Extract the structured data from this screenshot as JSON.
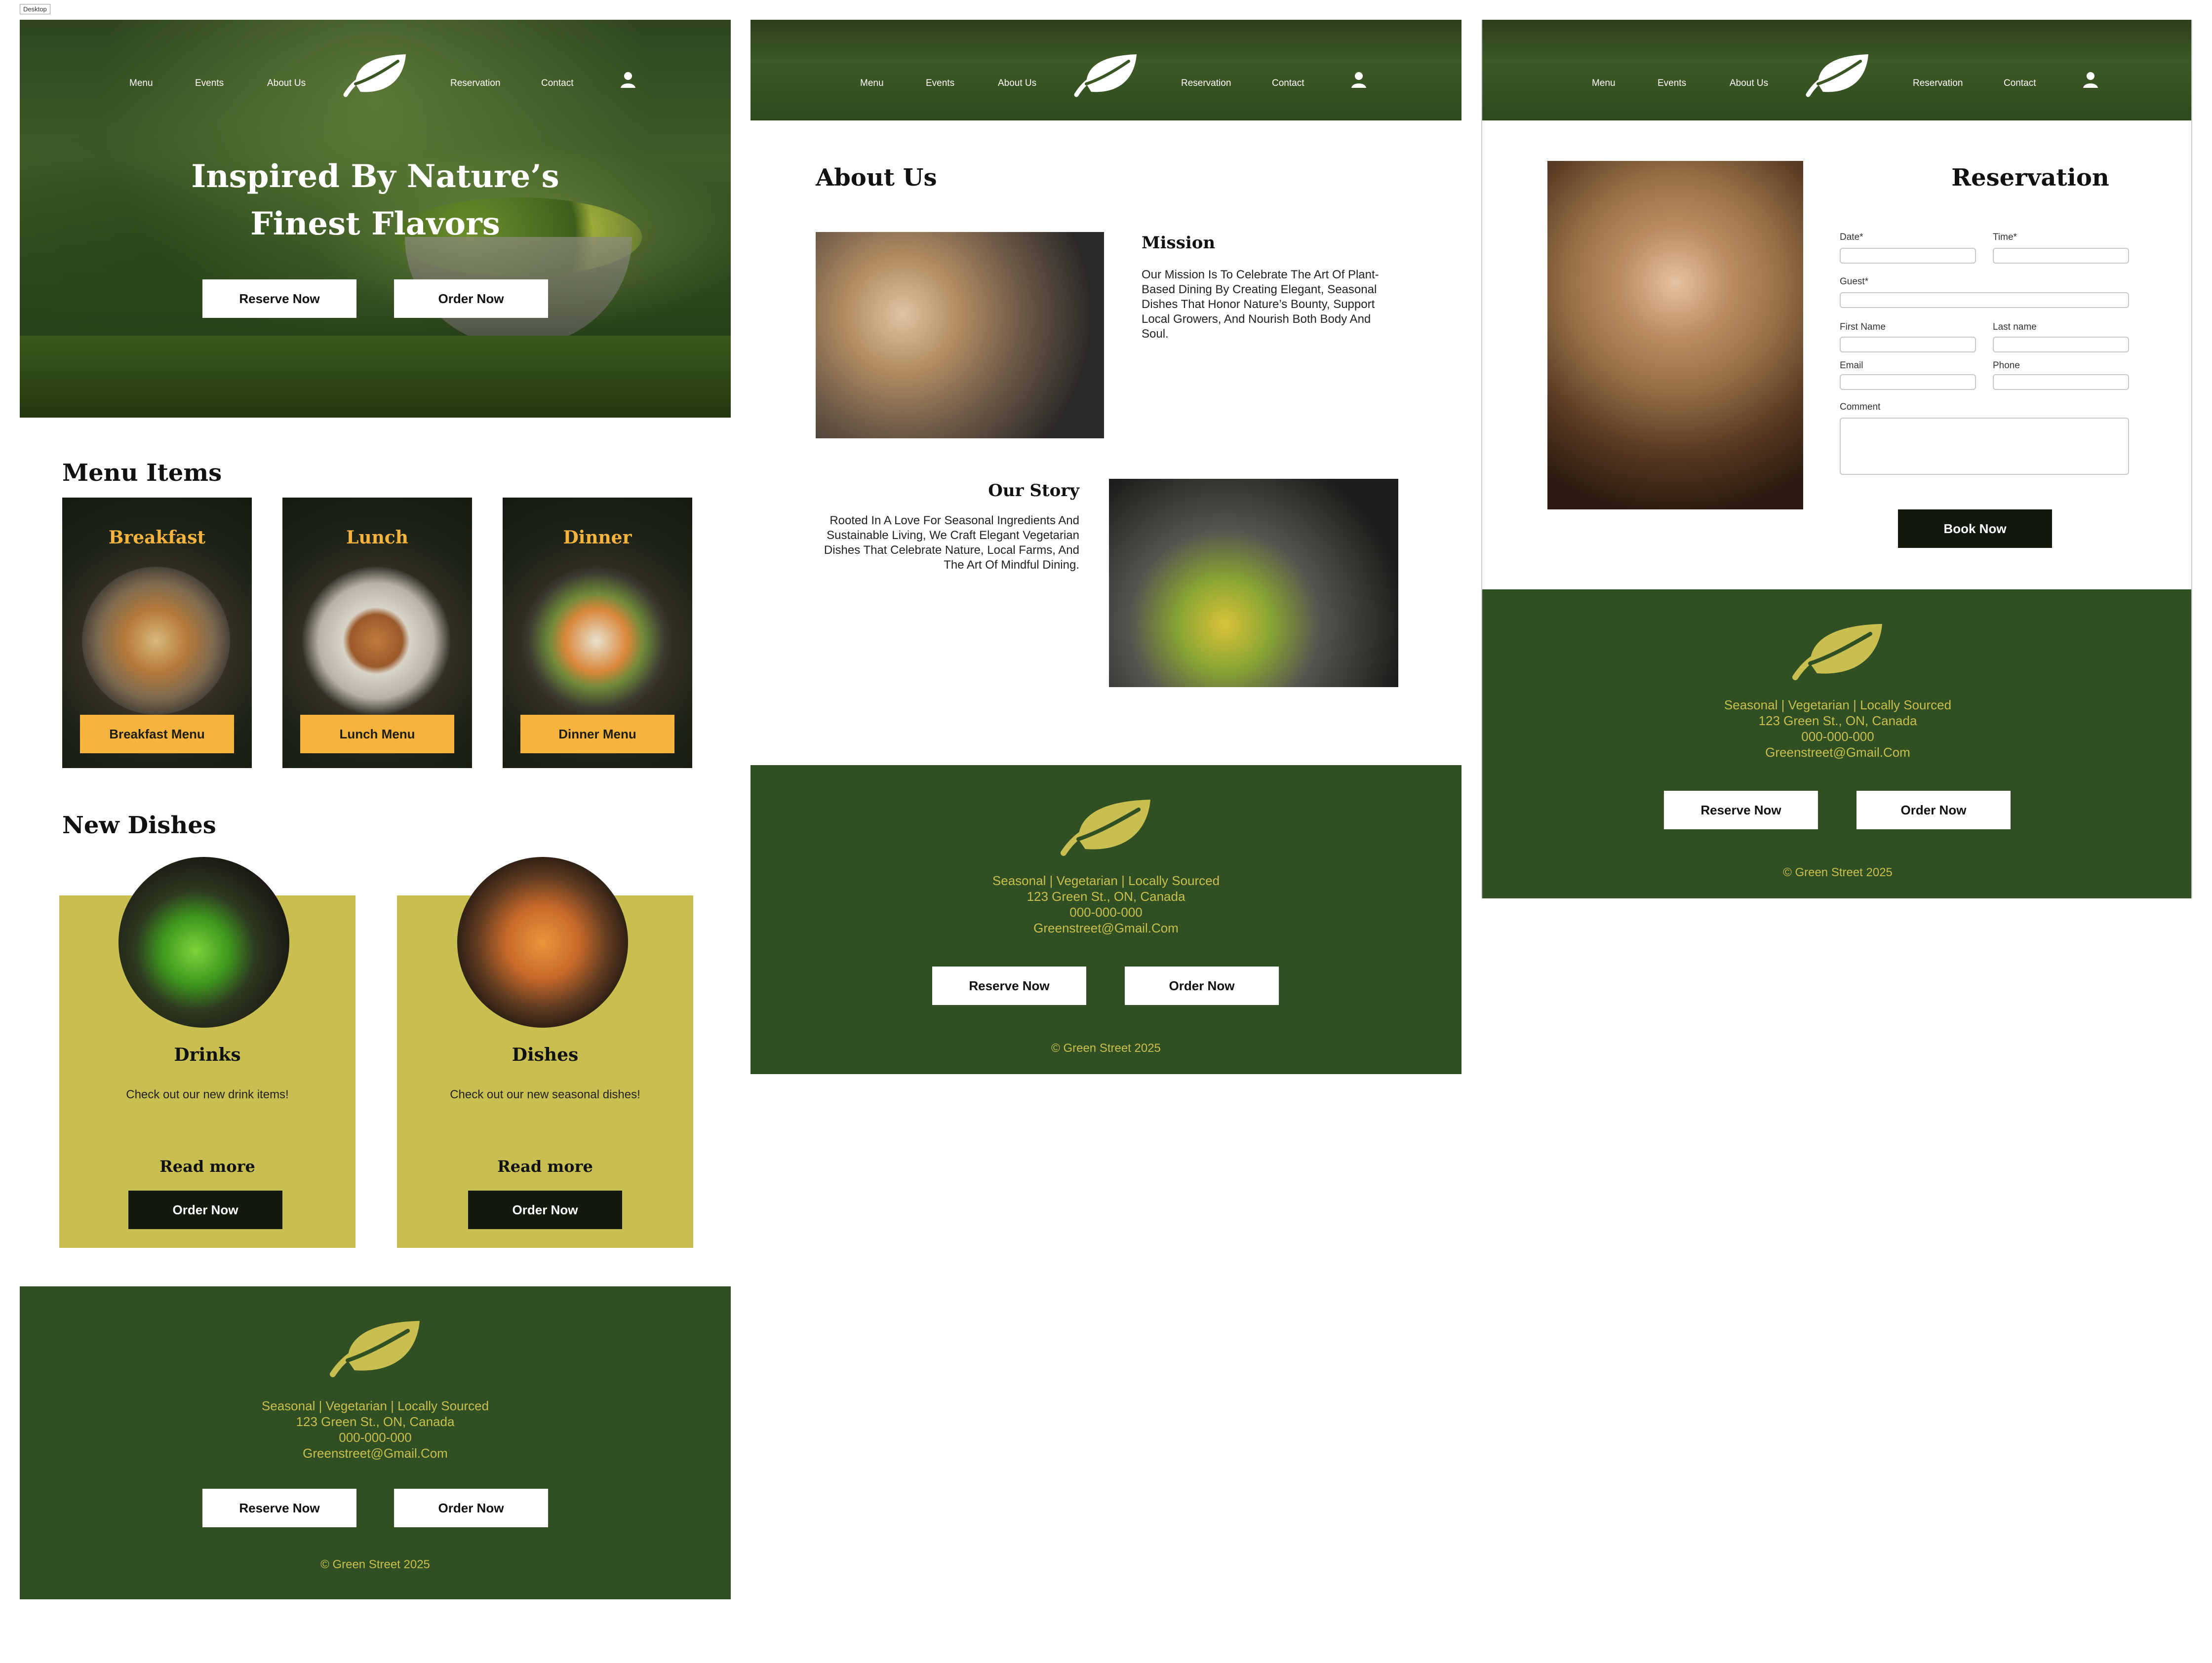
{
  "canvas_label": "Desktop",
  "nav": {
    "links": [
      "Menu",
      "Events",
      "About Us",
      "Reservation",
      "Contact"
    ],
    "logo_icon": "leaf-logo-icon",
    "user_icon": "user-icon"
  },
  "home": {
    "hero_title": "Inspired By Nature’s Finest Flavors",
    "reserve_label": "Reserve Now",
    "order_label": "Order Now",
    "menu_section_title": "Menu Items",
    "menu_cards": [
      {
        "title": "Breakfast",
        "button": "Breakfast Menu"
      },
      {
        "title": "Lunch",
        "button": "Lunch Menu"
      },
      {
        "title": "Dinner",
        "button": "Dinner Menu"
      }
    ],
    "new_dishes_title": "New Dishes",
    "dishes": [
      {
        "title": "Drinks",
        "text": "Check out our new drink items!",
        "read_more": "Read more",
        "button": "Order Now"
      },
      {
        "title": "Dishes",
        "text": "Check out our new seasonal dishes!",
        "read_more": "Read more",
        "button": "Order Now"
      }
    ]
  },
  "about": {
    "title": "About Us",
    "mission_title": "Mission",
    "mission_text": "Our Mission Is To Celebrate The Art Of Plant-Based Dining By Creating Elegant, Seasonal Dishes That Honor Nature’s Bounty, Support Local Growers, And Nourish Both Body And Soul.",
    "story_title": "Our Story",
    "story_text": "Rooted In A Love For Seasonal Ingredients And Sustainable Living, We Craft Elegant Vegetarian Dishes That Celebrate Nature, Local Farms, And The Art Of Mindful Dining."
  },
  "reservation": {
    "title": "Reservation",
    "labels": {
      "date": "Date*",
      "time": "Time*",
      "guest": "Guest*",
      "first_name": "First Name",
      "last_name": "Last name",
      "email": "Email",
      "phone": "Phone",
      "comment": "Comment"
    },
    "book_label": "Book Now"
  },
  "footer": {
    "tagline": "Seasonal | Vegetarian | Locally Sourced",
    "address": "123 Green St., ON, Canada",
    "phone": "000-000-000",
    "email": "Greenstreet@Gmail.Com",
    "reserve_label": "Reserve Now",
    "order_label": "Order Now",
    "copyright": "© Green Street 2025"
  },
  "colors": {
    "footer_bg": "#304f22",
    "accent_olive": "#c8bf50",
    "accent_amber": "#f6b43f",
    "dark_button": "#121a0e"
  }
}
